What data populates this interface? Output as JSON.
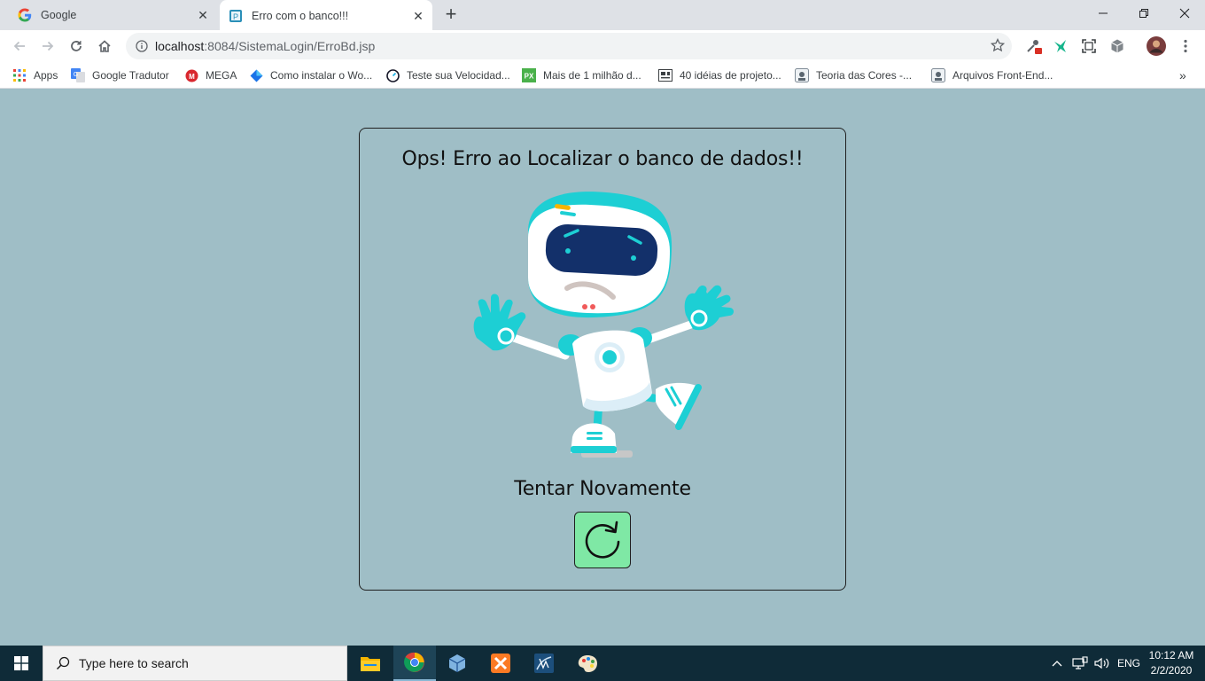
{
  "browser": {
    "tabs": [
      {
        "title": "Google",
        "icon": "google-icon",
        "active": false
      },
      {
        "title": "Erro com o banco!!!",
        "icon": "page-icon",
        "active": true
      }
    ],
    "new_tab_label": "+",
    "url_host": "localhost",
    "url_rest": ":8084/SistemaLogin/ErroBd.jsp",
    "bookmarks": [
      {
        "label": "Apps",
        "icon": "apps-grid-icon"
      },
      {
        "label": "Google Tradutor",
        "icon": "translate-icon"
      },
      {
        "label": "MEGA",
        "icon": "mega-icon"
      },
      {
        "label": "Como instalar o Wo...",
        "icon": "diamond-icon"
      },
      {
        "label": "Teste sua Velocidad...",
        "icon": "speedtest-icon"
      },
      {
        "label": "Mais de 1 milhão d...",
        "icon": "px-icon"
      },
      {
        "label": "40 idéias de projeto...",
        "icon": "board-icon"
      },
      {
        "label": "Teoria das Cores -...",
        "icon": "site-icon"
      },
      {
        "label": "Arquivos Front-End...",
        "icon": "site-icon"
      }
    ],
    "overflow_label": "»"
  },
  "page": {
    "heading": "Ops! Erro ao Localizar o banco de dados!!",
    "illustration": "sad-robot",
    "retry_label": "Tentar Novamente",
    "retry_icon": "refresh-icon",
    "colors": {
      "background": "#9fbec6",
      "button": "#7fe8a5",
      "robot_accent": "#1dcfd4",
      "visor": "#13306a"
    }
  },
  "taskbar": {
    "search_placeholder": "Type here to search",
    "apps": [
      "file-explorer-icon",
      "chrome-icon",
      "virtualbox-icon",
      "xampp-icon",
      "mysql-workbench-icon",
      "paint-icon"
    ],
    "language": "ENG",
    "time": "10:12 AM",
    "date": "2/2/2020"
  }
}
